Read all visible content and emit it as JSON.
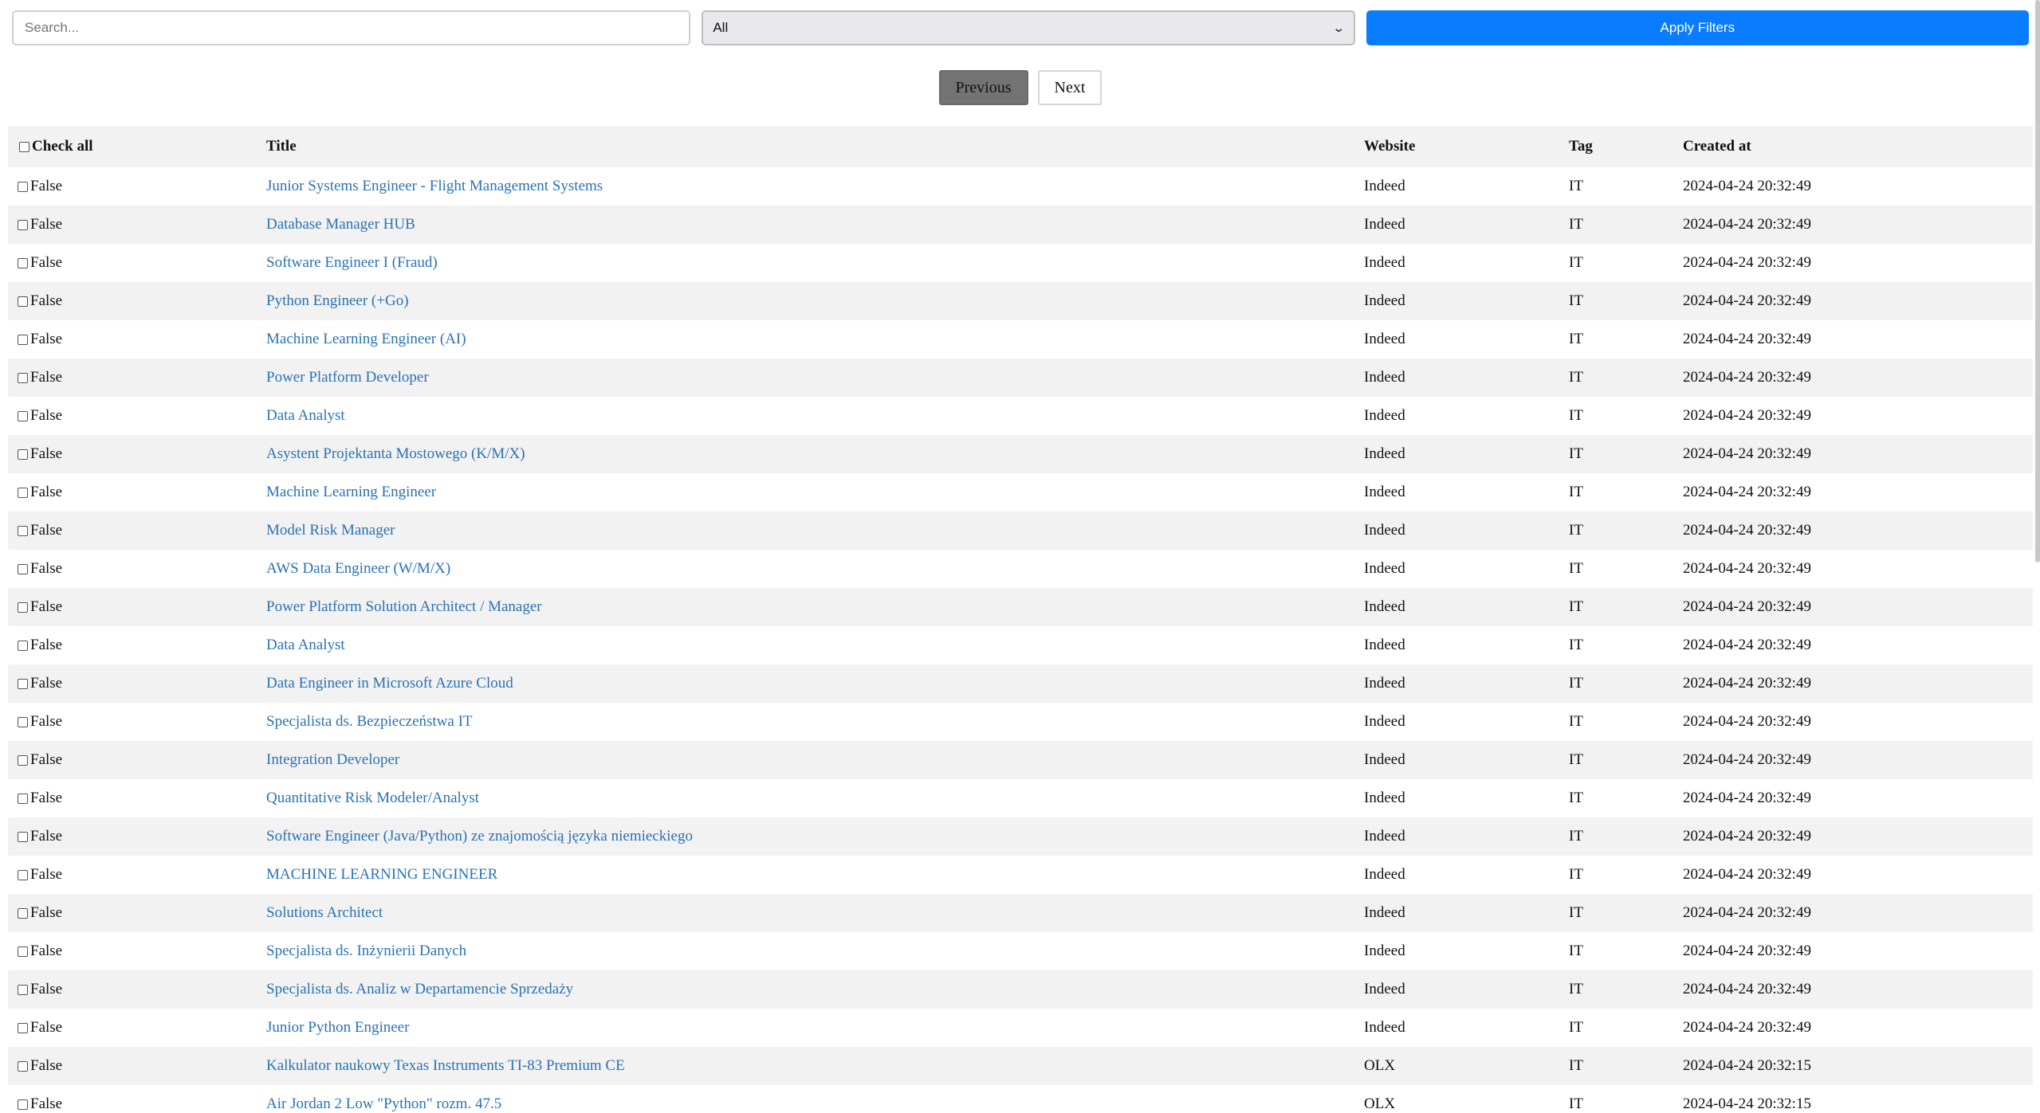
{
  "filters": {
    "search_placeholder": "Search...",
    "select_value": "All",
    "apply_label": "Apply Filters",
    "accent_color": "#0a7cff"
  },
  "pagination": {
    "previous_label": "Previous",
    "next_label": "Next"
  },
  "table": {
    "columns": {
      "check_all": "Check all",
      "title": "Title",
      "website": "Website",
      "tag": "Tag",
      "created_at": "Created at"
    },
    "rows": [
      {
        "checked": "False",
        "title": "Junior Systems Engineer - Flight Management Systems",
        "website": "Indeed",
        "tag": "IT",
        "created_at": "2024-04-24 20:32:49"
      },
      {
        "checked": "False",
        "title": "Database Manager HUB",
        "website": "Indeed",
        "tag": "IT",
        "created_at": "2024-04-24 20:32:49"
      },
      {
        "checked": "False",
        "title": "Software Engineer I (Fraud)",
        "website": "Indeed",
        "tag": "IT",
        "created_at": "2024-04-24 20:32:49"
      },
      {
        "checked": "False",
        "title": "Python Engineer (+Go)",
        "website": "Indeed",
        "tag": "IT",
        "created_at": "2024-04-24 20:32:49"
      },
      {
        "checked": "False",
        "title": "Machine Learning Engineer (AI)",
        "website": "Indeed",
        "tag": "IT",
        "created_at": "2024-04-24 20:32:49"
      },
      {
        "checked": "False",
        "title": "Power Platform Developer",
        "website": "Indeed",
        "tag": "IT",
        "created_at": "2024-04-24 20:32:49"
      },
      {
        "checked": "False",
        "title": "Data Analyst",
        "website": "Indeed",
        "tag": "IT",
        "created_at": "2024-04-24 20:32:49"
      },
      {
        "checked": "False",
        "title": "Asystent Projektanta Mostowego (K/M/X)",
        "website": "Indeed",
        "tag": "IT",
        "created_at": "2024-04-24 20:32:49"
      },
      {
        "checked": "False",
        "title": "Machine Learning Engineer",
        "website": "Indeed",
        "tag": "IT",
        "created_at": "2024-04-24 20:32:49"
      },
      {
        "checked": "False",
        "title": "Model Risk Manager",
        "website": "Indeed",
        "tag": "IT",
        "created_at": "2024-04-24 20:32:49"
      },
      {
        "checked": "False",
        "title": "AWS Data Engineer (W/M/X)",
        "website": "Indeed",
        "tag": "IT",
        "created_at": "2024-04-24 20:32:49"
      },
      {
        "checked": "False",
        "title": "Power Platform Solution Architect / Manager",
        "website": "Indeed",
        "tag": "IT",
        "created_at": "2024-04-24 20:32:49"
      },
      {
        "checked": "False",
        "title": "Data Analyst",
        "website": "Indeed",
        "tag": "IT",
        "created_at": "2024-04-24 20:32:49"
      },
      {
        "checked": "False",
        "title": "Data Engineer in Microsoft Azure Cloud",
        "website": "Indeed",
        "tag": "IT",
        "created_at": "2024-04-24 20:32:49"
      },
      {
        "checked": "False",
        "title": "Specjalista ds. Bezpieczeństwa IT",
        "website": "Indeed",
        "tag": "IT",
        "created_at": "2024-04-24 20:32:49"
      },
      {
        "checked": "False",
        "title": "Integration Developer",
        "website": "Indeed",
        "tag": "IT",
        "created_at": "2024-04-24 20:32:49"
      },
      {
        "checked": "False",
        "title": "Quantitative Risk Modeler/Analyst",
        "website": "Indeed",
        "tag": "IT",
        "created_at": "2024-04-24 20:32:49"
      },
      {
        "checked": "False",
        "title": "Software Engineer (Java/Python) ze znajomością języka niemieckiego",
        "website": "Indeed",
        "tag": "IT",
        "created_at": "2024-04-24 20:32:49"
      },
      {
        "checked": "False",
        "title": "MACHINE LEARNING ENGINEER",
        "website": "Indeed",
        "tag": "IT",
        "created_at": "2024-04-24 20:32:49"
      },
      {
        "checked": "False",
        "title": "Solutions Architect",
        "website": "Indeed",
        "tag": "IT",
        "created_at": "2024-04-24 20:32:49"
      },
      {
        "checked": "False",
        "title": "Specjalista ds. Inżynierii Danych",
        "website": "Indeed",
        "tag": "IT",
        "created_at": "2024-04-24 20:32:49"
      },
      {
        "checked": "False",
        "title": "Specjalista ds. Analiz w Departamencie Sprzedaży",
        "website": "Indeed",
        "tag": "IT",
        "created_at": "2024-04-24 20:32:49"
      },
      {
        "checked": "False",
        "title": "Junior Python Engineer",
        "website": "Indeed",
        "tag": "IT",
        "created_at": "2024-04-24 20:32:49"
      },
      {
        "checked": "False",
        "title": "Kalkulator naukowy Texas Instruments TI-83 Premium CE",
        "website": "OLX",
        "tag": "IT",
        "created_at": "2024-04-24 20:32:15"
      },
      {
        "checked": "False",
        "title": "Air Jordan 2 Low \"Python\" rozm. 47.5",
        "website": "OLX",
        "tag": "IT",
        "created_at": "2024-04-24 20:32:15"
      }
    ]
  }
}
